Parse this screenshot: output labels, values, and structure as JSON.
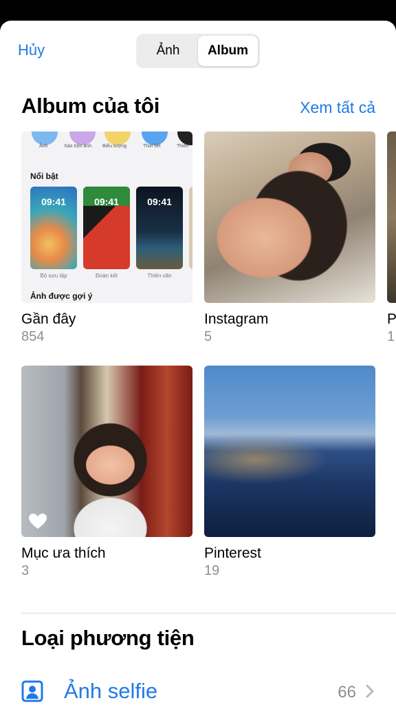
{
  "header": {
    "cancel_label": "Hủy",
    "tabs": [
      {
        "label": "Ảnh",
        "active": false
      },
      {
        "label": "Album",
        "active": true
      }
    ]
  },
  "my_albums": {
    "title": "Album của tôi",
    "see_all_label": "Xem tất cả",
    "items": [
      {
        "name": "Gần đây",
        "count": "854"
      },
      {
        "name": "Instagram",
        "count": "5"
      },
      {
        "name": "P",
        "count": "1"
      },
      {
        "name": "Mục ưa thích",
        "count": "3"
      },
      {
        "name": "Pinterest",
        "count": "19"
      }
    ],
    "recent_thumb": {
      "icon_labels": [
        "Ảnh",
        "Xáo trộn ảnh",
        "Biểu tượng",
        "Thời tiết",
        "Thiên"
      ],
      "featured_title": "Nổi bật",
      "wallpapers": [
        {
          "time": "09:41",
          "label": "Bộ sưu tập"
        },
        {
          "time": "09:41",
          "label": "Đoàn kết"
        },
        {
          "time": "09:41",
          "label": "Thiên văn"
        }
      ],
      "suggested_title": "Ảnh được gợi ý"
    }
  },
  "media_types": {
    "title": "Loại phương tiện",
    "items": [
      {
        "label": "Ảnh selfie",
        "count": "66",
        "icon": "portrait-icon"
      }
    ]
  },
  "colors": {
    "accent": "#1f7ae8",
    "secondary_text": "#8e8e93",
    "background": "#ffffff"
  }
}
